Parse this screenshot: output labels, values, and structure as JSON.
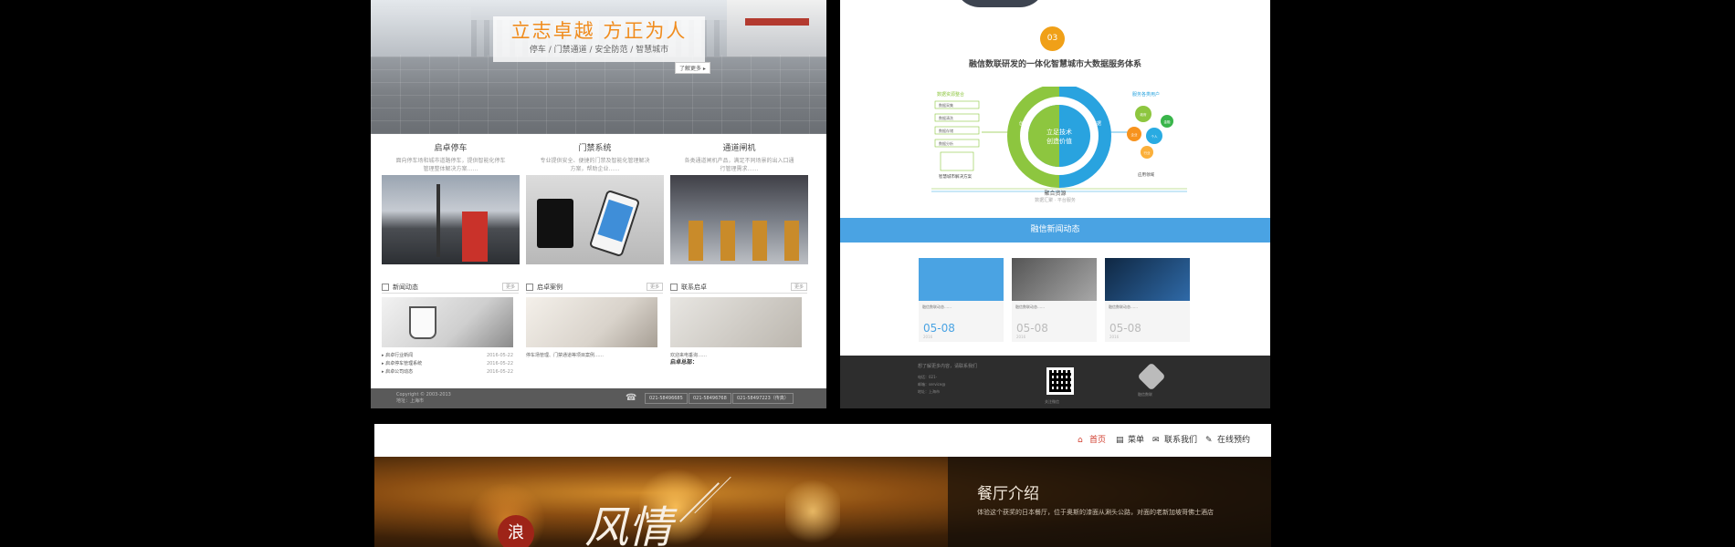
{
  "site_a": {
    "hero": {
      "slogan": "立志卓越 方正为人",
      "subtitle": "停车 / 门禁通道 / 安全防范 / 智慧城市",
      "more": "了解更多 ▸"
    },
    "products": [
      {
        "title": "启卓停车",
        "desc": "面向停车场和城市道路停车，提供智能化停车管理整体解决方案……"
      },
      {
        "title": "门禁系统",
        "desc": "专业提供安全、便捷的门禁及智能化管理解决方案，帮助企业……"
      },
      {
        "title": "通道闸机",
        "desc": "各类通道闸机产品，满足不同场景的出入口通行管理需求……"
      }
    ],
    "news": {
      "title": "新闻动态",
      "more": "更多",
      "items": [
        {
          "text": "▸ 启卓行业新闻",
          "date": "2016-05-22"
        },
        {
          "text": "▸ 启卓停车管理系统",
          "date": "2016-05-22"
        },
        {
          "text": "▸ 启卓公司动态",
          "date": "2016-05-22"
        }
      ]
    },
    "cases": {
      "title": "启卓案例",
      "more": "更多",
      "text": "停车场管理、门禁通道等项目案例……"
    },
    "contact": {
      "title": "联系启卓",
      "more": "更多",
      "line1": "欢迎来电垂询……",
      "addr_label": "启卓总部："
    },
    "footer": {
      "copyright": "Copyright © 2003-2013",
      "address": "地址：上海市",
      "phone_icon": "☎",
      "tels": [
        "021-58496685",
        "021-58496768",
        "021-58497223（传真）"
      ]
    }
  },
  "site_b": {
    "step": "03",
    "heading": "融信数联研发的一体化智慧城市大数据服务体系",
    "diagram": {
      "center_line1": "立足技术",
      "center_line2": "创造价值",
      "left_label": "创新",
      "right_label": "数据",
      "left_title": "数据资源整合",
      "right_title": "服务各类用户",
      "left_items": [
        "数据采集",
        "数据清洗",
        "数据存储",
        "数据分析"
      ],
      "left_bottom": "智慧城市解决方案",
      "right_bottom": "应用领域",
      "bubbles": [
        {
          "label": "政府",
          "color": "#8dc63f"
        },
        {
          "label": "企业",
          "color": "#f7931e"
        },
        {
          "label": "个人",
          "color": "#29abe2"
        },
        {
          "label": "行业",
          "color": "#fbb03b"
        },
        {
          "label": "金融",
          "color": "#39b54a"
        }
      ],
      "colors": {
        "green": "#8dc63f",
        "blue": "#29a3df"
      }
    },
    "diagram_footer": "聚合资源",
    "diagram_footer2": "数据汇聚 · 平台服务",
    "band": "融信新闻动态",
    "news": [
      {
        "text": "融信数联动态……",
        "date": "05-08",
        "year": "2016"
      },
      {
        "text": "融信数联动态……",
        "date": "05-08",
        "year": "2016"
      },
      {
        "text": "融信数联动态……",
        "date": "05-08",
        "year": "2016"
      }
    ],
    "footer": {
      "cta": "想了解更多内容，请联系我们",
      "lines": [
        "电话：021-",
        "邮箱：service@",
        "地址：上海市"
      ],
      "qr_caption": "关注微信",
      "logo_caption": "融信数联"
    }
  },
  "site_c": {
    "nav": [
      {
        "icon": "⌂",
        "label": "首页",
        "active": true
      },
      {
        "icon": "▤",
        "label": "菜单",
        "active": false
      },
      {
        "icon": "✉",
        "label": "联系我们",
        "active": false
      },
      {
        "icon": "✎",
        "label": "在线预约",
        "active": false
      }
    ],
    "seal": "浪",
    "calligraphy": "风情",
    "panel_title": "餐厅介绍",
    "panel_text": "体验这个获奖的日本餐厅，位于奥斯的漆面从涮头公路，对面的老新加坡哥佛士酒店"
  }
}
